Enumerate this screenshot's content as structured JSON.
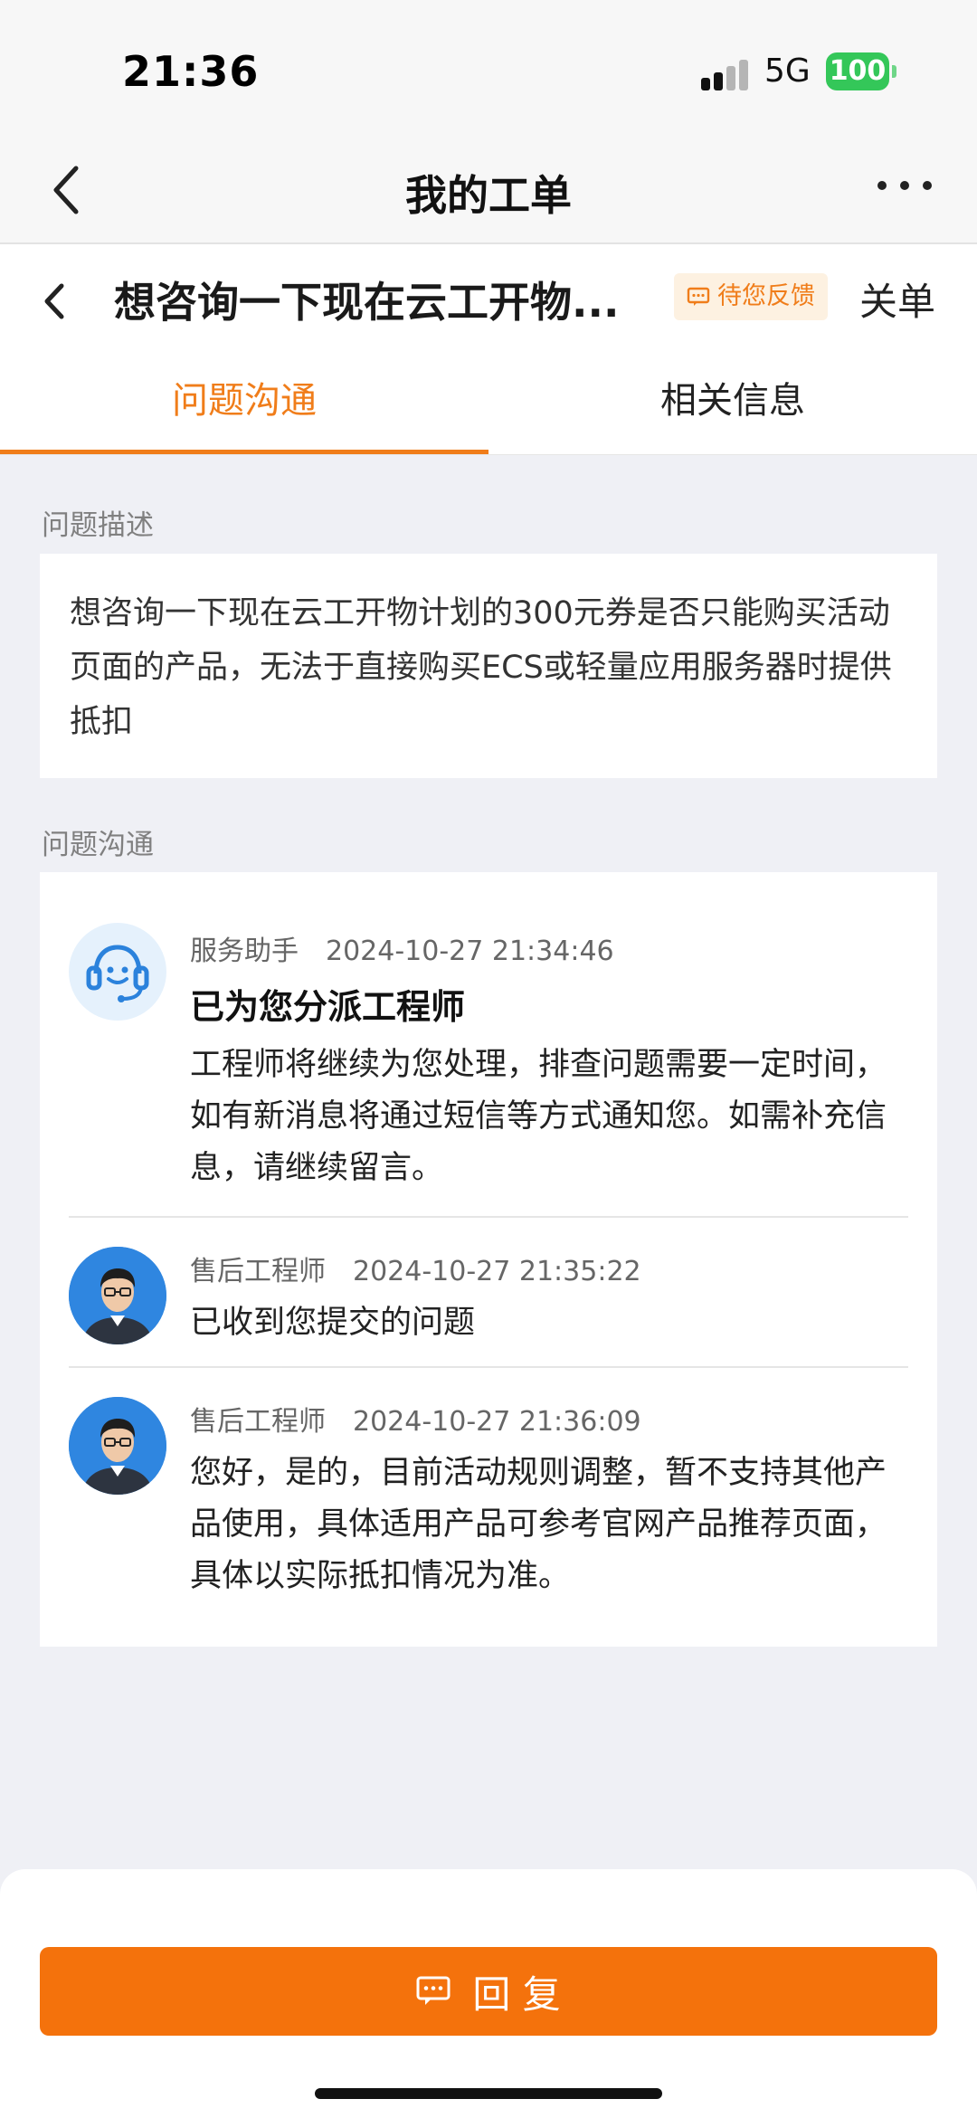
{
  "status_bar": {
    "time": "21:36",
    "network": "5G",
    "battery": "100"
  },
  "nav": {
    "title": "我的工单"
  },
  "ticket": {
    "title": "想咨询一下现在云工开物...",
    "badge": "待您反馈",
    "close_label": "关单"
  },
  "tabs": [
    {
      "label": "问题沟通",
      "active": true
    },
    {
      "label": "相关信息",
      "active": false
    }
  ],
  "description": {
    "section_label": "问题描述",
    "text": "想咨询一下现在云工开物计划的300元券是否只能购买活动页面的产品，无法于直接购买ECS或轻量应用服务器时提供抵扣"
  },
  "communication": {
    "section_label": "问题沟通",
    "messages": [
      {
        "sender": "服务助手",
        "time": "2024-10-27 21:34:46",
        "title": "已为您分派工程师",
        "body": "工程师将继续为您处理，排查问题需要一定时间，如有新消息将通过短信等方式通知您。如需补充信息，请继续留言。"
      },
      {
        "sender": "售后工程师",
        "time": "2024-10-27 21:35:22",
        "body": "已收到您提交的问题"
      },
      {
        "sender": "售后工程师",
        "time": "2024-10-27 21:36:09",
        "body": "您好，是的，目前活动规则调整，暂不支持其他产品使用，具体适用产品可参考官网产品推荐页面，具体以实际抵扣情况为准。"
      }
    ]
  },
  "reply_button": {
    "label": "回 复"
  },
  "colors": {
    "accent": "#f07d1a",
    "button": "#f4720c",
    "battery": "#34c759"
  }
}
